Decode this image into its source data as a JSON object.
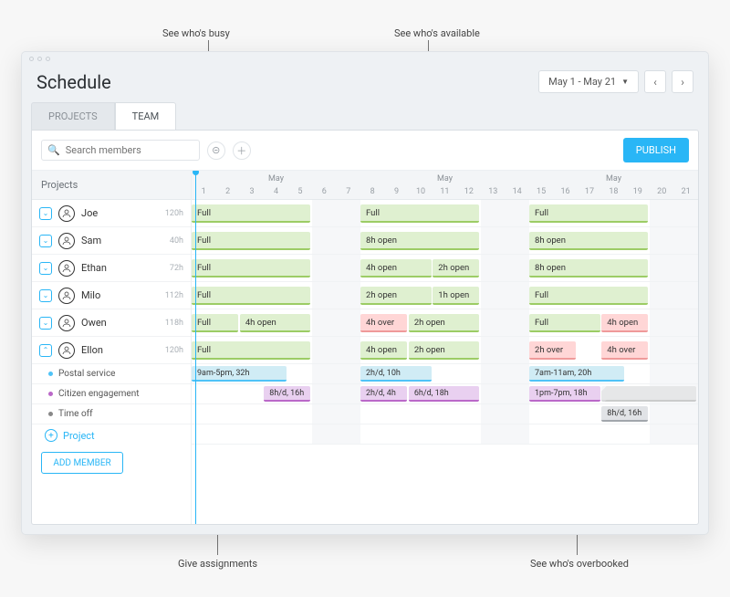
{
  "callouts": {
    "busy": "See who's busy",
    "available": "See who's available",
    "assignments": "Give assignments",
    "overbooked": "See who's overbooked"
  },
  "header": {
    "title": "Schedule",
    "date_range": "May 1 - May 21"
  },
  "tabs": {
    "projects": "PROJECTS",
    "team": "TEAM"
  },
  "toolbar": {
    "search_placeholder": "Search members",
    "publish": "PUBLISH"
  },
  "left_header": "Projects",
  "month_label": "May",
  "days": [
    1,
    2,
    3,
    4,
    5,
    6,
    7,
    8,
    9,
    10,
    11,
    12,
    13,
    14,
    15,
    16,
    17,
    18,
    19,
    20,
    21
  ],
  "members": [
    {
      "name": "Joe",
      "hours": "120h",
      "bars": [
        {
          "col": 1,
          "span": 5,
          "cls": "g",
          "label": "Full"
        },
        {
          "col": 8,
          "span": 5,
          "cls": "g",
          "label": "Full"
        },
        {
          "col": 15,
          "span": 5,
          "cls": "g",
          "label": "Full"
        }
      ]
    },
    {
      "name": "Sam",
      "hours": "40h",
      "bars": [
        {
          "col": 1,
          "span": 5,
          "cls": "g",
          "label": "Full"
        },
        {
          "col": 8,
          "span": 5,
          "cls": "g",
          "label": "8h open"
        },
        {
          "col": 15,
          "span": 5,
          "cls": "g",
          "label": "8h open"
        }
      ]
    },
    {
      "name": "Ethan",
      "hours": "72h",
      "bars": [
        {
          "col": 1,
          "span": 5,
          "cls": "g",
          "label": "Full"
        },
        {
          "col": 8,
          "span": 3,
          "cls": "g",
          "label": "4h open"
        },
        {
          "col": 11,
          "span": 2,
          "cls": "g",
          "label": "2h open"
        },
        {
          "col": 15,
          "span": 5,
          "cls": "g",
          "label": "8h open"
        }
      ]
    },
    {
      "name": "Milo",
      "hours": "112h",
      "bars": [
        {
          "col": 1,
          "span": 5,
          "cls": "g",
          "label": "Full"
        },
        {
          "col": 8,
          "span": 3,
          "cls": "g",
          "label": "2h open"
        },
        {
          "col": 11,
          "span": 2,
          "cls": "g",
          "label": "1h open"
        },
        {
          "col": 15,
          "span": 5,
          "cls": "g",
          "label": "Full"
        }
      ]
    },
    {
      "name": "Owen",
      "hours": "118h",
      "bars": [
        {
          "col": 1,
          "span": 2,
          "cls": "g",
          "label": "Full"
        },
        {
          "col": 3,
          "span": 3,
          "cls": "g",
          "label": "4h open"
        },
        {
          "col": 8,
          "span": 2,
          "cls": "r",
          "label": "4h over"
        },
        {
          "col": 10,
          "span": 3,
          "cls": "g",
          "label": "2h open"
        },
        {
          "col": 15,
          "span": 3,
          "cls": "g",
          "label": "Full"
        },
        {
          "col": 18,
          "span": 2,
          "cls": "r",
          "label": "4h open"
        }
      ]
    },
    {
      "name": "Ellon",
      "hours": "120h",
      "expanded": true,
      "bars": [
        {
          "col": 1,
          "span": 5,
          "cls": "g",
          "label": "Full"
        },
        {
          "col": 8,
          "span": 2,
          "cls": "g",
          "label": "4h open"
        },
        {
          "col": 10,
          "span": 3,
          "cls": "g",
          "label": "2h open"
        },
        {
          "col": 15,
          "span": 2,
          "cls": "r",
          "label": "2h over"
        },
        {
          "col": 18,
          "span": 2,
          "cls": "r",
          "label": "4h over"
        }
      ]
    }
  ],
  "subrows": [
    {
      "name": "Postal service",
      "color": "#4fc3f7",
      "bars": [
        {
          "col": 1,
          "span": 4,
          "cls": "b",
          "label": "9am-5pm, 32h"
        },
        {
          "col": 8,
          "span": 3,
          "cls": "b",
          "label": "2h/d, 10h"
        },
        {
          "col": 15,
          "span": 4,
          "cls": "b",
          "label": "7am-11am, 20h"
        }
      ]
    },
    {
      "name": "Citizen engagement",
      "color": "#ba68c8",
      "bars": [
        {
          "col": 4,
          "span": 2,
          "cls": "p",
          "label": "8h/d, 16h"
        },
        {
          "col": 8,
          "span": 2,
          "cls": "p",
          "label": "2h/d, 4h"
        },
        {
          "col": 10,
          "span": 3,
          "cls": "p",
          "label": "6h/d, 18h"
        },
        {
          "col": 15,
          "span": 3,
          "cls": "p",
          "label": "1pm-7pm, 18h"
        },
        {
          "col": 18,
          "span": 4,
          "cls": "hatch",
          "label": ""
        }
      ]
    },
    {
      "name": "Time off",
      "color": "#888",
      "bars": [
        {
          "col": 18,
          "span": 2,
          "cls": "gr",
          "label": "8h/d, 16h"
        }
      ]
    }
  ],
  "add_project": "Project",
  "add_member": "ADD MEMBER",
  "colors": {
    "accent": "#29b6f6"
  }
}
